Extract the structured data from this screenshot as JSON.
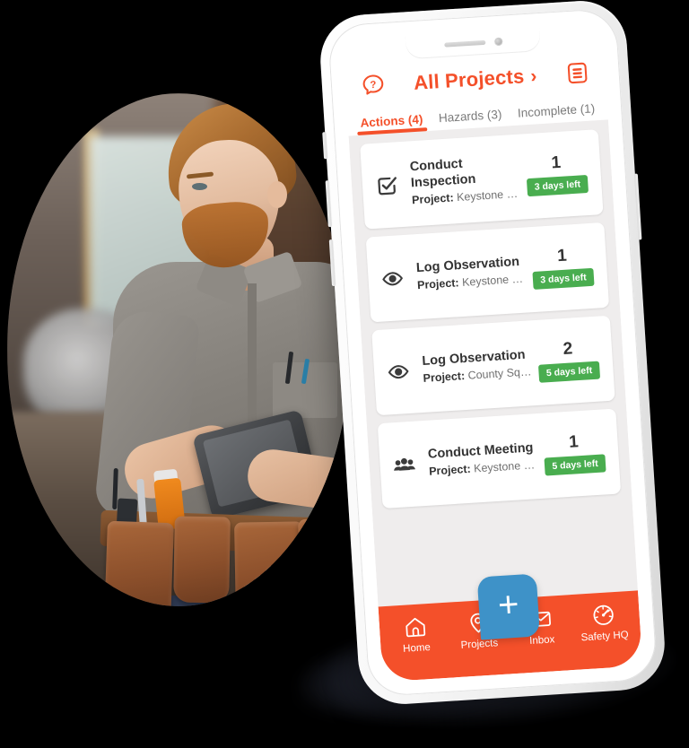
{
  "background": {
    "color": "#000000"
  },
  "theme": {
    "brand_orange": "#f4502a",
    "badge_green": "#49ad4f",
    "add_blue": "#3e92c8",
    "list_bg": "#efeded",
    "card_bg": "#ffffff"
  },
  "photo": {
    "alt": "Construction worker in grey shirt with brown leather tool belt using a tablet",
    "shape": "circle"
  },
  "phone": {
    "notch": {
      "speaker_icon": "speaker-grille-icon",
      "camera_icon": "front-camera-icon"
    },
    "side_buttons": [
      "mute-switch",
      "volume-up",
      "volume-down",
      "power"
    ]
  },
  "header": {
    "help_icon": "question-speech-bubble-icon",
    "title": "All Projects",
    "chevron": "›",
    "list_icon": "document-list-icon"
  },
  "tabs": [
    {
      "label": "Actions (4)",
      "active": true
    },
    {
      "label": "Hazards (3)",
      "active": false
    },
    {
      "label": "Incomplete (1)",
      "active": false
    }
  ],
  "actions": [
    {
      "icon": "checkbox-checked-icon",
      "title": "Conduct Inspection",
      "project_label": "Project:",
      "project_name": "Keystone Project",
      "count": "1",
      "badge": "3 days left"
    },
    {
      "icon": "eye-icon",
      "title": "Log Observation",
      "project_label": "Project:",
      "project_name": "Keystone Project",
      "count": "1",
      "badge": "3 days left"
    },
    {
      "icon": "eye-icon",
      "title": "Log Observation",
      "project_label": "Project:",
      "project_name": "County Square",
      "count": "2",
      "badge": "5 days left"
    },
    {
      "icon": "people-group-icon",
      "title": "Conduct Meeting",
      "project_label": "Project:",
      "project_name": "Keystone Project",
      "count": "1",
      "badge": "5 days left"
    }
  ],
  "bottom_nav": {
    "items": [
      {
        "icon": "home-icon",
        "label": "Home"
      },
      {
        "icon": "map-pin-icon",
        "label": "Projects"
      },
      {
        "icon": "envelope-icon",
        "label": "Inbox"
      },
      {
        "icon": "speedometer-icon",
        "label": "Safety HQ"
      }
    ],
    "add_button": {
      "icon": "plus-icon",
      "label": "+"
    }
  }
}
